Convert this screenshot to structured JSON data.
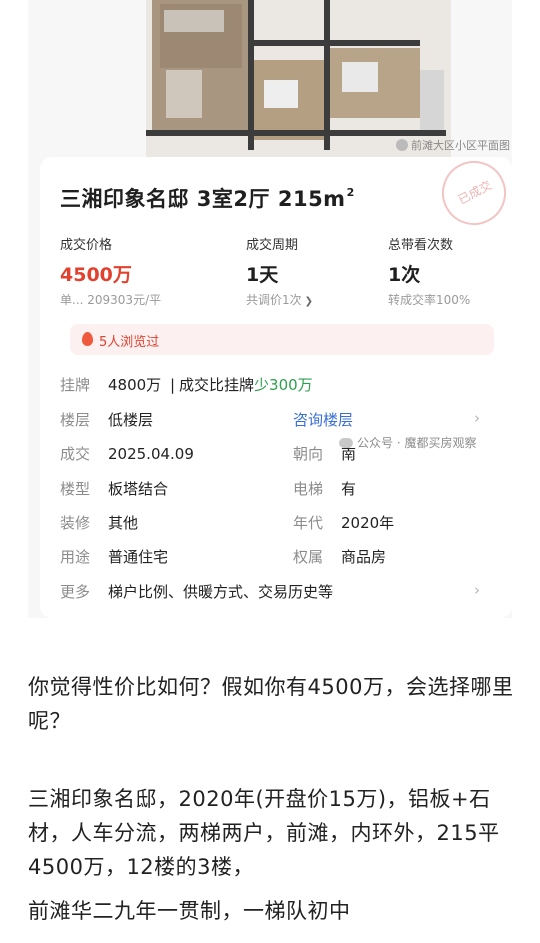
{
  "image": {
    "floorplan_caption": "前滩大区小区平面图",
    "card": {
      "title": "三湘印象名邸 3室2厅 215m",
      "title_sup": "2",
      "stamp": "已成交",
      "stats": [
        {
          "label": "成交价格",
          "value": "4500万",
          "sub": "单... 209303元/平"
        },
        {
          "label": "成交周期",
          "value": "1天",
          "sub": "共调价1次"
        },
        {
          "label": "总带看次数",
          "value": "1次",
          "sub": "转成交率100%"
        }
      ],
      "viewed": "5人浏览过",
      "listing": {
        "key": "挂牌",
        "value": "4800万",
        "sep": "|",
        "compare_label": "成交比挂牌",
        "compare_value": "少300万"
      },
      "floor": {
        "key": "楼层",
        "value": "低楼层",
        "action": "咨询楼层"
      },
      "details_left": [
        {
          "key": "成交",
          "value": "2025.04.09"
        },
        {
          "key": "楼型",
          "value": "板塔结合"
        },
        {
          "key": "装修",
          "value": "其他"
        },
        {
          "key": "用途",
          "value": "普通住宅"
        }
      ],
      "details_right": [
        {
          "key": "朝向",
          "value": "南"
        },
        {
          "key": "电梯",
          "value": "有"
        },
        {
          "key": "年代",
          "value": "2020年"
        },
        {
          "key": "权属",
          "value": "商品房"
        }
      ],
      "more": {
        "key": "更多",
        "value": "梯户比例、供暖方式、交易历史等"
      },
      "watermark": "公众号 · 魔都买房观察"
    }
  },
  "article": {
    "p1": "你觉得性价比如何？假如你有4500万，会选择哪里呢？",
    "p2": "三湘印象名邸，2020年(开盘价15万)，铝板+石材，人车分流，两梯两户，前滩，内环外，215平4500万，12楼的3楼，",
    "p3": "前滩华二九年一贯制，一梯队初中"
  }
}
